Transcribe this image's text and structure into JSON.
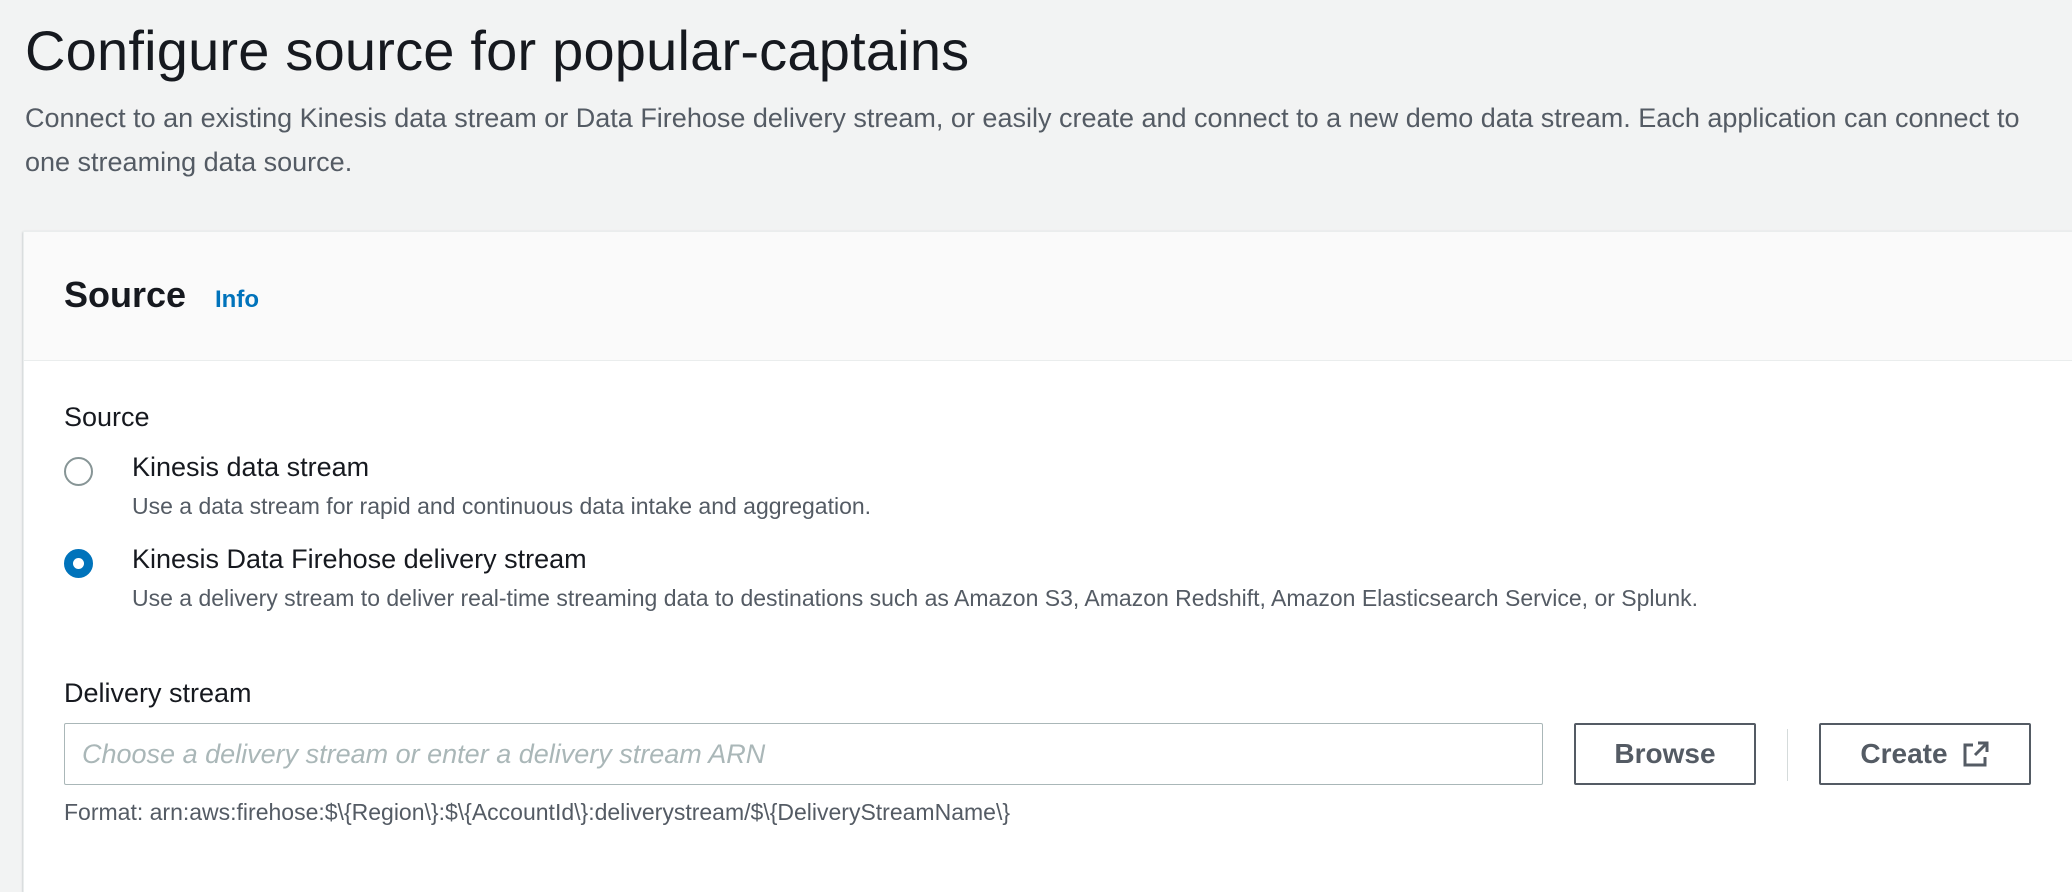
{
  "header": {
    "title": "Configure source for popular-captains",
    "description": "Connect to an existing Kinesis data stream or Data Firehose delivery stream, or easily create and connect to a new demo data stream. Each application can connect to one streaming data source."
  },
  "panel": {
    "title": "Source",
    "info_link": "Info"
  },
  "source_field": {
    "label": "Source",
    "selected": "firehose",
    "options": [
      {
        "id": "kinesis",
        "label": "Kinesis data stream",
        "description": "Use a data stream for rapid and continuous data intake and aggregation.",
        "checked": false
      },
      {
        "id": "firehose",
        "label": "Kinesis Data Firehose delivery stream",
        "description": "Use a delivery stream to deliver real-time streaming data to destinations such as Amazon S3, Amazon Redshift, Amazon Elasticsearch Service, or Splunk.",
        "checked": true
      }
    ]
  },
  "delivery_stream": {
    "label": "Delivery stream",
    "value": "",
    "placeholder": "Choose a delivery stream or enter a delivery stream ARN",
    "browse_label": "Browse",
    "create_label": "Create",
    "create_icon": "external-link-icon",
    "format_hint": "Format: arn:aws:firehose:$\\{Region\\}:$\\{AccountId\\}:deliverystream/$\\{DeliveryStreamName\\}"
  },
  "colors": {
    "accent": "#0073bb",
    "background": "#f2f3f3",
    "text": "#16191f",
    "secondary_text": "#545b64",
    "border": "#aab7b8"
  }
}
